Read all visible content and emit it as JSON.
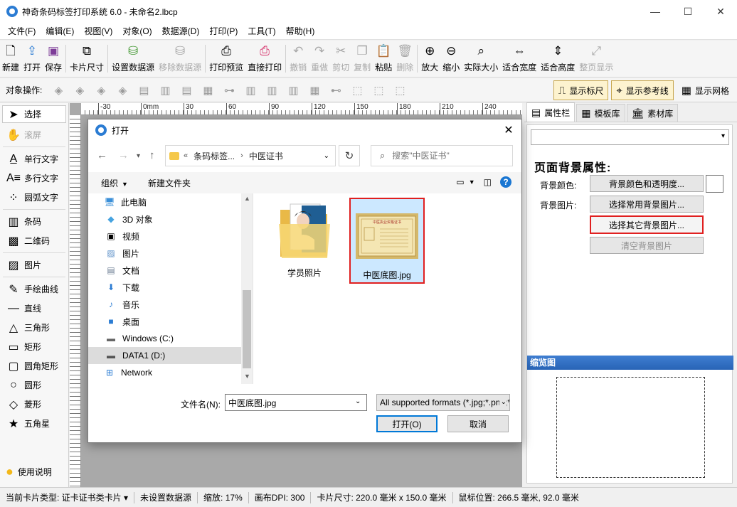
{
  "window": {
    "title": "神奇条码标签打印系统 6.0 - 未命名2.lbcp",
    "minimize": "—",
    "maximize": "☐",
    "close": "✕"
  },
  "menu": [
    "文件(F)",
    "编辑(E)",
    "视图(V)",
    "对象(O)",
    "数据源(D)",
    "打印(P)",
    "工具(T)",
    "帮助(H)"
  ],
  "toolbar": {
    "new": "新建",
    "open": "打开",
    "save": "保存",
    "card_size": "卡片尺寸",
    "set_datasource": "设置数据源",
    "remove_datasource": "移除数据源",
    "print_preview": "打印预览",
    "direct_print": "直接打印",
    "undo": "撤销",
    "redo": "重做",
    "cut": "剪切",
    "copy": "复制",
    "paste": "粘贴",
    "delete": "删除",
    "zoom_in": "放大",
    "zoom_out": "缩小",
    "actual_size": "实际大小",
    "fit_width": "适合宽度",
    "fit_height": "适合高度",
    "fit_page": "整页显示"
  },
  "objbar": {
    "label": "对象操作:",
    "show_ruler": "显示标尺",
    "show_guides": "显示参考线",
    "show_grid": "显示网格"
  },
  "tools": {
    "select": "选择",
    "scroll": "滚屏",
    "single_text": "单行文字",
    "multi_text": "多行文字",
    "arc_text": "圆弧文字",
    "barcode": "条码",
    "qrcode": "二维码",
    "image": "图片",
    "freehand": "手绘曲线",
    "line": "直线",
    "triangle": "三角形",
    "rectangle": "矩形",
    "rounded_rect": "圆角矩形",
    "circle": "圆形",
    "diamond": "菱形",
    "star": "五角星",
    "help": "使用说明"
  },
  "ruler": {
    "h_ticks": [
      "-30",
      "0mm",
      "30",
      "60",
      "90",
      "120",
      "150",
      "180",
      "210",
      "240"
    ]
  },
  "right_panel": {
    "tabs": [
      "属性栏",
      "模板库",
      "素材库"
    ],
    "section_title": "页面背景属性:",
    "bg_color_label": "背景颜色:",
    "bg_color_button": "背景颜色和透明度...",
    "bg_image_label": "背景图片:",
    "common_bg_button": "选择常用背景图片...",
    "other_bg_button": "选择其它背景图片...",
    "clear_bg_button": "清空背景图片",
    "thumbnail_title": "缩览图"
  },
  "status": {
    "card_type": "当前卡片类型: 证卡证书类卡片 ▾",
    "datasource": "未设置数据源",
    "zoom": "缩放: 17%",
    "dpi": "画布DPI: 300",
    "card_size": "卡片尺寸: 220.0 毫米 x 150.0 毫米",
    "cursor": "鼠标位置: 266.5 毫米, 92.0 毫米"
  },
  "dialog": {
    "title": "打开",
    "address": {
      "prefix": "«",
      "crumb1": "条码标签...",
      "sep": "›",
      "crumb2": "中医证书"
    },
    "search_placeholder": "搜索\"中医证书\"",
    "organize": "组织",
    "new_folder": "新建文件夹",
    "nav": [
      {
        "label": "此电脑",
        "icon": "computer-icon"
      },
      {
        "label": "3D 对象",
        "icon": "cube-icon"
      },
      {
        "label": "视频",
        "icon": "video-icon"
      },
      {
        "label": "图片",
        "icon": "pictures-icon"
      },
      {
        "label": "文档",
        "icon": "documents-icon"
      },
      {
        "label": "下载",
        "icon": "download-icon"
      },
      {
        "label": "音乐",
        "icon": "music-icon"
      },
      {
        "label": "桌面",
        "icon": "desktop-icon"
      },
      {
        "label": "Windows (C:)",
        "icon": "drive-icon"
      },
      {
        "label": "DATA1 (D:)",
        "icon": "drive-icon"
      },
      {
        "label": "Network",
        "icon": "network-icon"
      }
    ],
    "files": [
      {
        "name": "学员照片",
        "type": "folder"
      },
      {
        "name": "中医底图.jpg",
        "type": "image"
      }
    ],
    "thumb_text": "中医执业资格证书",
    "filename_label": "文件名(N):",
    "filename_value": "中医底图.jpg",
    "filetype_value": "All supported formats (*.jpg;*.png;*.bmp)",
    "open_button": "打开(O)",
    "cancel_button": "取消"
  },
  "colors": {
    "accent": "#2b7cd3",
    "highlight_border": "#e02020",
    "selection": "#cce8ff",
    "thumb_header": "#2864b6"
  }
}
